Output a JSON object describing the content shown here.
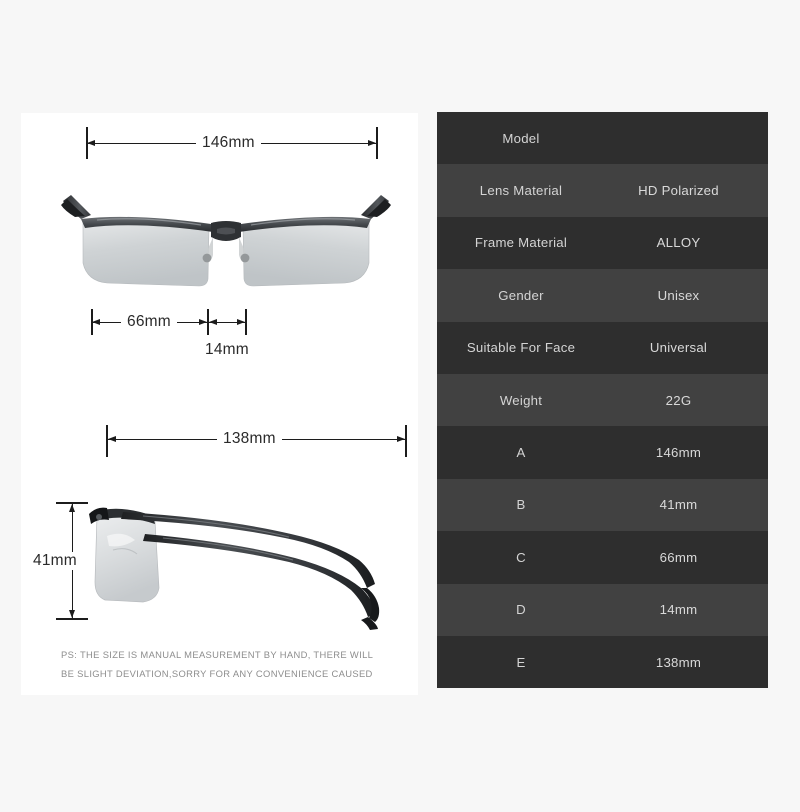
{
  "background_color": "#f7f7f7",
  "left_panel": {
    "background_color": "#ffffff",
    "dimensions": {
      "total_width": "146mm",
      "lens_span": "66mm",
      "bridge": "14mm",
      "temple_length": "138mm",
      "lens_height": "41mm"
    },
    "product": {
      "front_view_name": "sunglasses-front-view",
      "side_view_name": "sunglasses-side-view",
      "lens_color": "#cfd2d4",
      "frame_color": "#3a3d40"
    },
    "note_line_1": "PS: THE SIZE IS MANUAL MEASUREMENT BY HAND, THERE WILL",
    "note_line_2": "BE SLIGHT DEVIATION,SORRY FOR ANY CONVENIENCE CAUSED"
  },
  "spec_table": {
    "row_color_odd": "#2e2e2e",
    "row_color_even": "#414141",
    "text_color": "#d4d4d4",
    "rows": [
      {
        "label": "Model",
        "value": ""
      },
      {
        "label": "Lens Material",
        "value": "HD Polarized"
      },
      {
        "label": "Frame Material",
        "value": "ALLOY"
      },
      {
        "label": "Gender",
        "value": "Unisex"
      },
      {
        "label": "Suitable For Face",
        "value": "Universal"
      },
      {
        "label": "Weight",
        "value": "22G"
      },
      {
        "label": "A",
        "value": "146mm"
      },
      {
        "label": "B",
        "value": "41mm"
      },
      {
        "label": "C",
        "value": "66mm"
      },
      {
        "label": "D",
        "value": "14mm"
      },
      {
        "label": "E",
        "value": "138mm"
      }
    ]
  }
}
